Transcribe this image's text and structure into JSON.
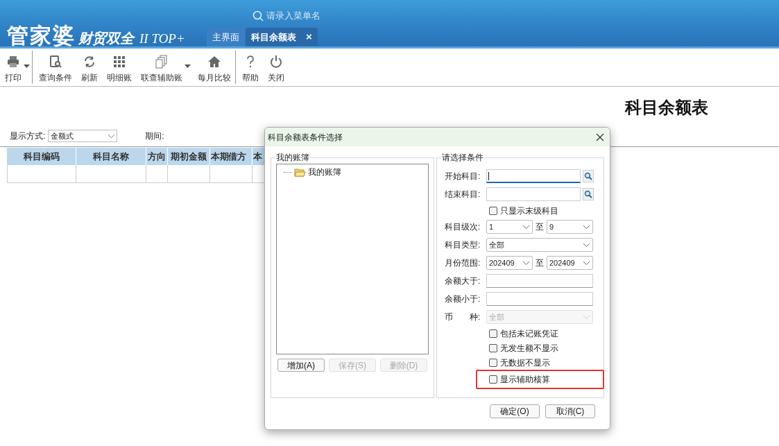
{
  "app": {
    "logo": "管家婆",
    "logo_subtitle": "财贸双全",
    "edition": "II TOP+",
    "search": {
      "placeholder": "请录入菜单名"
    },
    "tabs": [
      {
        "label": "主界面",
        "selected": false
      },
      {
        "label": "科目余额表",
        "selected": true,
        "close": "×"
      }
    ]
  },
  "toolbar": [
    {
      "label": "打印",
      "dropdown": true,
      "separator_after": true
    },
    {
      "label": "查询条件",
      "dropdown": false,
      "separator_after": false
    },
    {
      "label": "刷新",
      "dropdown": false,
      "separator_after": false
    },
    {
      "label": "明细账",
      "dropdown": false,
      "separator_after": false
    },
    {
      "label": "联查辅助账",
      "dropdown": true,
      "separator_after": false
    },
    {
      "label": "每月比较",
      "dropdown": false,
      "separator_after": true
    },
    {
      "label": "帮助",
      "dropdown": false,
      "separator_after": false
    },
    {
      "label": "关闭",
      "dropdown": false,
      "separator_after": false
    }
  ],
  "report": {
    "title": "科目余额表",
    "display_mode": {
      "label": "显示方式:",
      "value": "金额式"
    },
    "period_label": "期间:",
    "columns": [
      "科目编码",
      "科目名称",
      "方向",
      "期初金额",
      "本期借方",
      "本"
    ]
  },
  "dialog": {
    "title": "科目余额表条件选择",
    "left_group": {
      "legend": "我的账簿",
      "tree": [
        {
          "label": "我的账簿"
        }
      ],
      "buttons": [
        {
          "label": "增加(A)",
          "disabled": false
        },
        {
          "label": "保存(S)",
          "disabled": true
        },
        {
          "label": "删除(D)",
          "disabled": true
        }
      ]
    },
    "right_group": {
      "legend": "请选择条件",
      "fields": [
        {
          "kind": "lookup",
          "label": "开始科目:",
          "focused": true
        },
        {
          "kind": "lookup",
          "label": "结束科目:",
          "focused": false
        },
        {
          "kind": "checkbox",
          "label": "只显示末级科目",
          "checked": false,
          "highlighted": false
        },
        {
          "kind": "range",
          "label": "科目级次:",
          "from": "1",
          "to_label": "至",
          "to": "9"
        },
        {
          "kind": "select",
          "label": "科目类型:",
          "value": "全部",
          "disabled": false
        },
        {
          "kind": "range",
          "label": "月份范围:",
          "from": "202409",
          "to_label": "至",
          "to": "202409"
        },
        {
          "kind": "text",
          "label": "余额大于:"
        },
        {
          "kind": "text",
          "label": "余额小于:"
        },
        {
          "kind": "select",
          "label": "币　　种:",
          "value": "全部",
          "disabled": true
        },
        {
          "kind": "checkbox",
          "label": "包括未记账凭证",
          "checked": false,
          "highlighted": false
        },
        {
          "kind": "checkbox",
          "label": "无发生额不显示",
          "checked": false,
          "highlighted": false
        },
        {
          "kind": "checkbox",
          "label": "无数据不显示",
          "checked": false,
          "highlighted": false
        },
        {
          "kind": "checkbox",
          "label": "显示辅助核算",
          "checked": false,
          "highlighted": true
        }
      ]
    },
    "buttons": [
      {
        "label": "确定(O)"
      },
      {
        "label": "取消(C)"
      }
    ]
  }
}
